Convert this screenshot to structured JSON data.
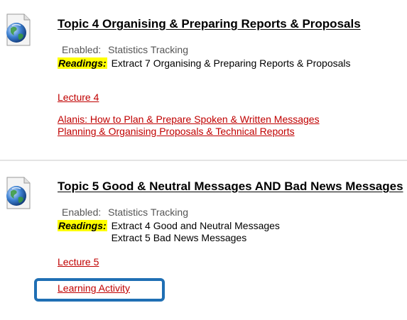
{
  "topics": [
    {
      "title": "Topic 4 Organising & Preparing Reports & Proposals",
      "enabled_label": "Enabled:",
      "status": "Statistics Tracking",
      "readings_label": "Readings:",
      "extracts": [
        "Extract 7 Organising & Preparing Reports & Proposals"
      ],
      "lecture_link": "Lecture 4",
      "links": [
        "Alanis: How to Plan & Prepare Spoken & Written Messages",
        "Planning & Organising Proposals & Technical Reports"
      ]
    },
    {
      "title": "Topic 5 Good & Neutral Messages AND Bad News Messages",
      "enabled_label": "Enabled:",
      "status": "Statistics Tracking",
      "readings_label": "Readings:",
      "extracts": [
        "Extract 4 Good and Neutral Messages",
        "Extract 5 Bad News Messages"
      ],
      "lecture_link": "Lecture 5",
      "links": [
        "Learning Activity"
      ]
    }
  ],
  "icons": {
    "item": "globe-document-icon"
  },
  "colors": {
    "link": "#c00000",
    "readings_highlight": "#ffff00",
    "callout_border": "#1f6fb4"
  }
}
